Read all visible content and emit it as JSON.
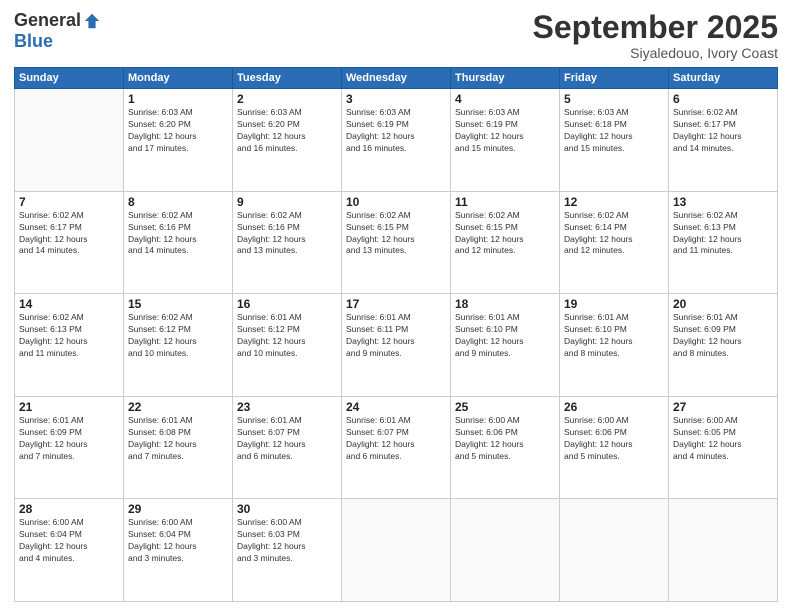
{
  "logo": {
    "general": "General",
    "blue": "Blue"
  },
  "header": {
    "month": "September 2025",
    "location": "Siyaledouo, Ivory Coast"
  },
  "days": [
    "Sunday",
    "Monday",
    "Tuesday",
    "Wednesday",
    "Thursday",
    "Friday",
    "Saturday"
  ],
  "weeks": [
    [
      {
        "day": "",
        "info": ""
      },
      {
        "day": "1",
        "info": "Sunrise: 6:03 AM\nSunset: 6:20 PM\nDaylight: 12 hours\nand 17 minutes."
      },
      {
        "day": "2",
        "info": "Sunrise: 6:03 AM\nSunset: 6:20 PM\nDaylight: 12 hours\nand 16 minutes."
      },
      {
        "day": "3",
        "info": "Sunrise: 6:03 AM\nSunset: 6:19 PM\nDaylight: 12 hours\nand 16 minutes."
      },
      {
        "day": "4",
        "info": "Sunrise: 6:03 AM\nSunset: 6:19 PM\nDaylight: 12 hours\nand 15 minutes."
      },
      {
        "day": "5",
        "info": "Sunrise: 6:03 AM\nSunset: 6:18 PM\nDaylight: 12 hours\nand 15 minutes."
      },
      {
        "day": "6",
        "info": "Sunrise: 6:02 AM\nSunset: 6:17 PM\nDaylight: 12 hours\nand 14 minutes."
      }
    ],
    [
      {
        "day": "7",
        "info": "Sunrise: 6:02 AM\nSunset: 6:17 PM\nDaylight: 12 hours\nand 14 minutes."
      },
      {
        "day": "8",
        "info": "Sunrise: 6:02 AM\nSunset: 6:16 PM\nDaylight: 12 hours\nand 14 minutes."
      },
      {
        "day": "9",
        "info": "Sunrise: 6:02 AM\nSunset: 6:16 PM\nDaylight: 12 hours\nand 13 minutes."
      },
      {
        "day": "10",
        "info": "Sunrise: 6:02 AM\nSunset: 6:15 PM\nDaylight: 12 hours\nand 13 minutes."
      },
      {
        "day": "11",
        "info": "Sunrise: 6:02 AM\nSunset: 6:15 PM\nDaylight: 12 hours\nand 12 minutes."
      },
      {
        "day": "12",
        "info": "Sunrise: 6:02 AM\nSunset: 6:14 PM\nDaylight: 12 hours\nand 12 minutes."
      },
      {
        "day": "13",
        "info": "Sunrise: 6:02 AM\nSunset: 6:13 PM\nDaylight: 12 hours\nand 11 minutes."
      }
    ],
    [
      {
        "day": "14",
        "info": "Sunrise: 6:02 AM\nSunset: 6:13 PM\nDaylight: 12 hours\nand 11 minutes."
      },
      {
        "day": "15",
        "info": "Sunrise: 6:02 AM\nSunset: 6:12 PM\nDaylight: 12 hours\nand 10 minutes."
      },
      {
        "day": "16",
        "info": "Sunrise: 6:01 AM\nSunset: 6:12 PM\nDaylight: 12 hours\nand 10 minutes."
      },
      {
        "day": "17",
        "info": "Sunrise: 6:01 AM\nSunset: 6:11 PM\nDaylight: 12 hours\nand 9 minutes."
      },
      {
        "day": "18",
        "info": "Sunrise: 6:01 AM\nSunset: 6:10 PM\nDaylight: 12 hours\nand 9 minutes."
      },
      {
        "day": "19",
        "info": "Sunrise: 6:01 AM\nSunset: 6:10 PM\nDaylight: 12 hours\nand 8 minutes."
      },
      {
        "day": "20",
        "info": "Sunrise: 6:01 AM\nSunset: 6:09 PM\nDaylight: 12 hours\nand 8 minutes."
      }
    ],
    [
      {
        "day": "21",
        "info": "Sunrise: 6:01 AM\nSunset: 6:09 PM\nDaylight: 12 hours\nand 7 minutes."
      },
      {
        "day": "22",
        "info": "Sunrise: 6:01 AM\nSunset: 6:08 PM\nDaylight: 12 hours\nand 7 minutes."
      },
      {
        "day": "23",
        "info": "Sunrise: 6:01 AM\nSunset: 6:07 PM\nDaylight: 12 hours\nand 6 minutes."
      },
      {
        "day": "24",
        "info": "Sunrise: 6:01 AM\nSunset: 6:07 PM\nDaylight: 12 hours\nand 6 minutes."
      },
      {
        "day": "25",
        "info": "Sunrise: 6:00 AM\nSunset: 6:06 PM\nDaylight: 12 hours\nand 5 minutes."
      },
      {
        "day": "26",
        "info": "Sunrise: 6:00 AM\nSunset: 6:06 PM\nDaylight: 12 hours\nand 5 minutes."
      },
      {
        "day": "27",
        "info": "Sunrise: 6:00 AM\nSunset: 6:05 PM\nDaylight: 12 hours\nand 4 minutes."
      }
    ],
    [
      {
        "day": "28",
        "info": "Sunrise: 6:00 AM\nSunset: 6:04 PM\nDaylight: 12 hours\nand 4 minutes."
      },
      {
        "day": "29",
        "info": "Sunrise: 6:00 AM\nSunset: 6:04 PM\nDaylight: 12 hours\nand 3 minutes."
      },
      {
        "day": "30",
        "info": "Sunrise: 6:00 AM\nSunset: 6:03 PM\nDaylight: 12 hours\nand 3 minutes."
      },
      {
        "day": "",
        "info": ""
      },
      {
        "day": "",
        "info": ""
      },
      {
        "day": "",
        "info": ""
      },
      {
        "day": "",
        "info": ""
      }
    ]
  ]
}
